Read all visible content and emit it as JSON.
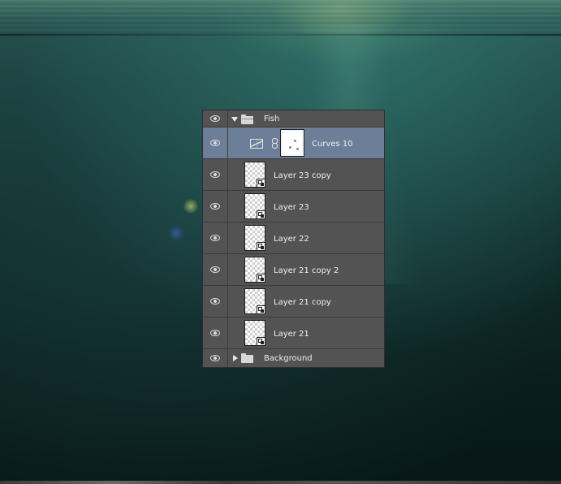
{
  "layers_panel": {
    "group": {
      "name": "Fish",
      "expanded": true
    },
    "adjustment": {
      "name": "Curves 10",
      "icon": "curves-icon",
      "selected": true
    },
    "layers": [
      {
        "name": "Layer 23 copy",
        "icon": "smart-object-icon"
      },
      {
        "name": "Layer 23",
        "icon": "smart-object-icon"
      },
      {
        "name": "Layer 22",
        "icon": "smart-object-icon"
      },
      {
        "name": "Layer 21 copy 2",
        "icon": "smart-object-icon"
      },
      {
        "name": "Layer 21 copy",
        "icon": "smart-object-icon"
      },
      {
        "name": "Layer 21",
        "icon": "smart-object-icon"
      }
    ],
    "background_group": {
      "name": "Background",
      "expanded": false
    },
    "colors": {
      "panel": "#535353",
      "selected_row": "#6d7f98",
      "text": "#f0f0f0"
    }
  }
}
